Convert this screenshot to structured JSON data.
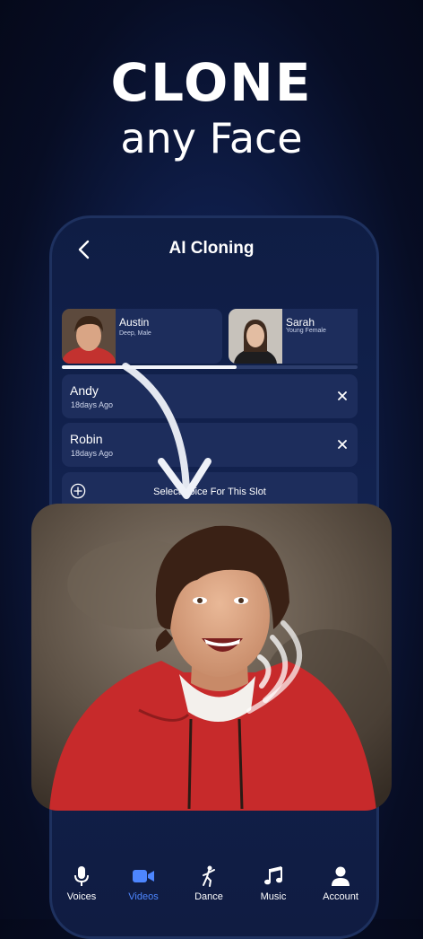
{
  "headline": {
    "line1": "CLONE",
    "line2": "any Face"
  },
  "screen": {
    "title": "AI Cloning"
  },
  "voices": [
    {
      "name": "Austin",
      "description": "Deep, Male"
    },
    {
      "name": "Sarah",
      "description": "Young Female"
    }
  ],
  "voice_carousel": {
    "progress": 0.59
  },
  "slots": [
    {
      "name": "Andy",
      "time": "18days Ago"
    },
    {
      "name": "Robin",
      "time": "18days Ago"
    }
  ],
  "select_slot": {
    "label": "Select Voice For This Slot"
  },
  "tabs": [
    {
      "label": "Voices",
      "icon": "microphone-icon",
      "active": false
    },
    {
      "label": "Videos",
      "icon": "video-camera-icon",
      "active": true
    },
    {
      "label": "Dance",
      "icon": "dancer-icon",
      "active": false
    },
    {
      "label": "Music",
      "icon": "music-note-icon",
      "active": false
    },
    {
      "label": "Account",
      "icon": "person-icon",
      "active": false
    }
  ],
  "colors": {
    "accent": "#4d86ff",
    "card": "#1d2d5c",
    "background": "#0b1433"
  }
}
